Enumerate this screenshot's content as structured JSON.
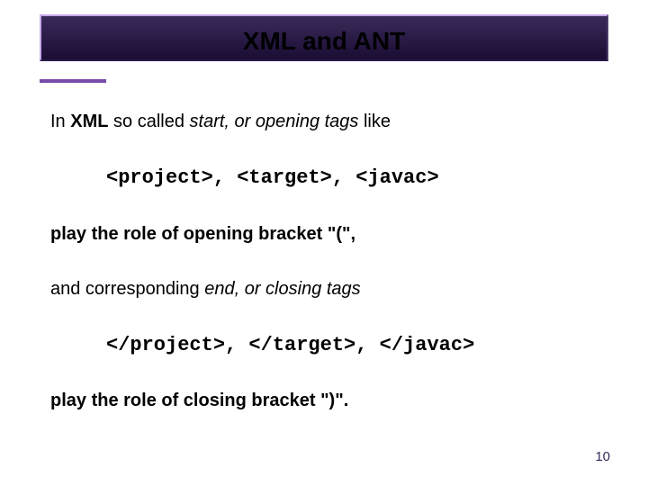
{
  "title": "XML and ANT",
  "line1_prefix": "In ",
  "line1_bold": "XML",
  "line1_mid": " so called ",
  "line1_italic": "start, or opening tags",
  "line1_suffix": " like",
  "code1": "<project>, <target>, <javac>",
  "line2": "play the role of opening bracket \"(\",",
  "line3_prefix": "and corresponding ",
  "line3_italic": "end, or closing tags",
  "code2": "</project>, </target>, </javac>",
  "line4": "play the role of closing bracket \")\".",
  "page_number": "10"
}
